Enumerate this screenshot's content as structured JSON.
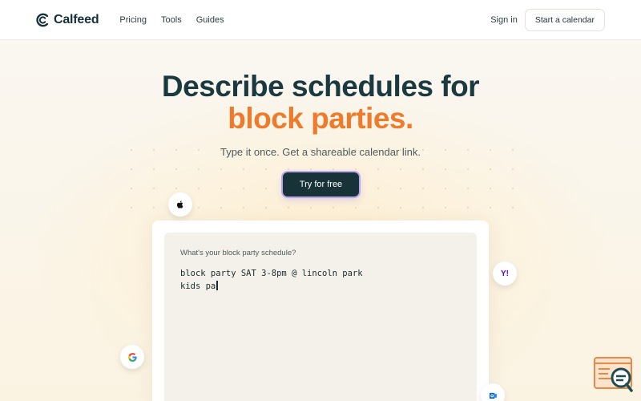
{
  "brand": {
    "name": "Calfeed"
  },
  "nav": {
    "items": [
      {
        "label": "Pricing"
      },
      {
        "label": "Tools"
      },
      {
        "label": "Guides"
      }
    ]
  },
  "header": {
    "sign_in_label": "Sign in",
    "start_label": "Start a calendar"
  },
  "hero": {
    "title_line1": "Describe schedules for",
    "title_line2": "block parties.",
    "subtitle": "Type it once. Get a shareable calendar link.",
    "cta_label": "Try for free"
  },
  "editor": {
    "prompt_label": "What's your block party schedule?",
    "line1": "block party SAT 3-8pm @ lincoln park",
    "line2": "kids pa"
  },
  "integrations": {
    "yahoo_label": "Y!"
  },
  "colors": {
    "accent": "#ee7a2b",
    "primary_dark": "#183338",
    "cta_ring": "#b9a6f2"
  },
  "icons": [
    "calfeed-logo-icon",
    "apple-icon",
    "google-icon",
    "yahoo-icon",
    "outlook-icon",
    "support-chat-icon"
  ]
}
